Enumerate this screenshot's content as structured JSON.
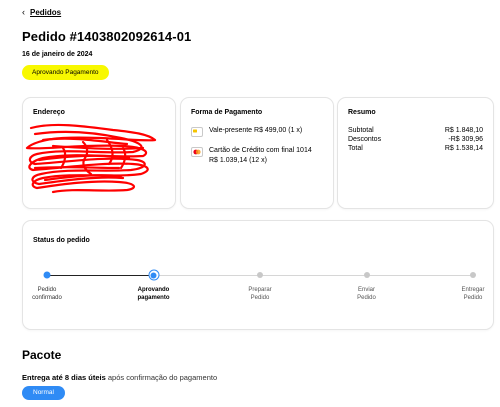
{
  "nav": {
    "back_label": "Pedidos"
  },
  "order": {
    "title": "Pedido #1403802092614-01",
    "date": "16 de janeiro de 2024",
    "status": "Aprovando Pagamento"
  },
  "address": {
    "title": "Endereço"
  },
  "payment": {
    "title": "Forma de Pagamento",
    "methods": [
      {
        "icon": "gift-card-icon",
        "line1": "Vale-presente R$ 499,00 (1 x)",
        "line2": ""
      },
      {
        "icon": "mastercard-icon",
        "line1": "Cartão de Crédito com final 1014",
        "line2": "R$ 1.039,14 (12 x)"
      }
    ]
  },
  "summary": {
    "title": "Resumo",
    "rows": [
      {
        "label": "Subtotal",
        "value": "R$ 1.848,10"
      },
      {
        "label": "Descontos",
        "value": "-R$ 309,96"
      },
      {
        "label": "Total",
        "value": "R$ 1.538,14"
      }
    ]
  },
  "tracking": {
    "title": "Status do pedido",
    "current_step": 1,
    "steps": [
      {
        "line1": "Pedido",
        "line2": "confirmado",
        "state": "done"
      },
      {
        "line1": "Aprovando",
        "line2": "pagamento",
        "state": "active"
      },
      {
        "line1": "Preparar",
        "line2": "Pedido",
        "state": "pending"
      },
      {
        "line1": "Enviar",
        "line2": "Pedido",
        "state": "pending"
      },
      {
        "line1": "Entregar",
        "line2": "Pedido",
        "state": "pending"
      }
    ]
  },
  "package": {
    "title": "Pacote",
    "delivery_bold": "Entrega até 8 dias úteis",
    "delivery_rest": " após confirmação do pagamento",
    "shipping_type": "Normal"
  },
  "colors": {
    "accent": "#2f8bf5",
    "badge": "#f8f800",
    "redaction": "#ff0000"
  }
}
